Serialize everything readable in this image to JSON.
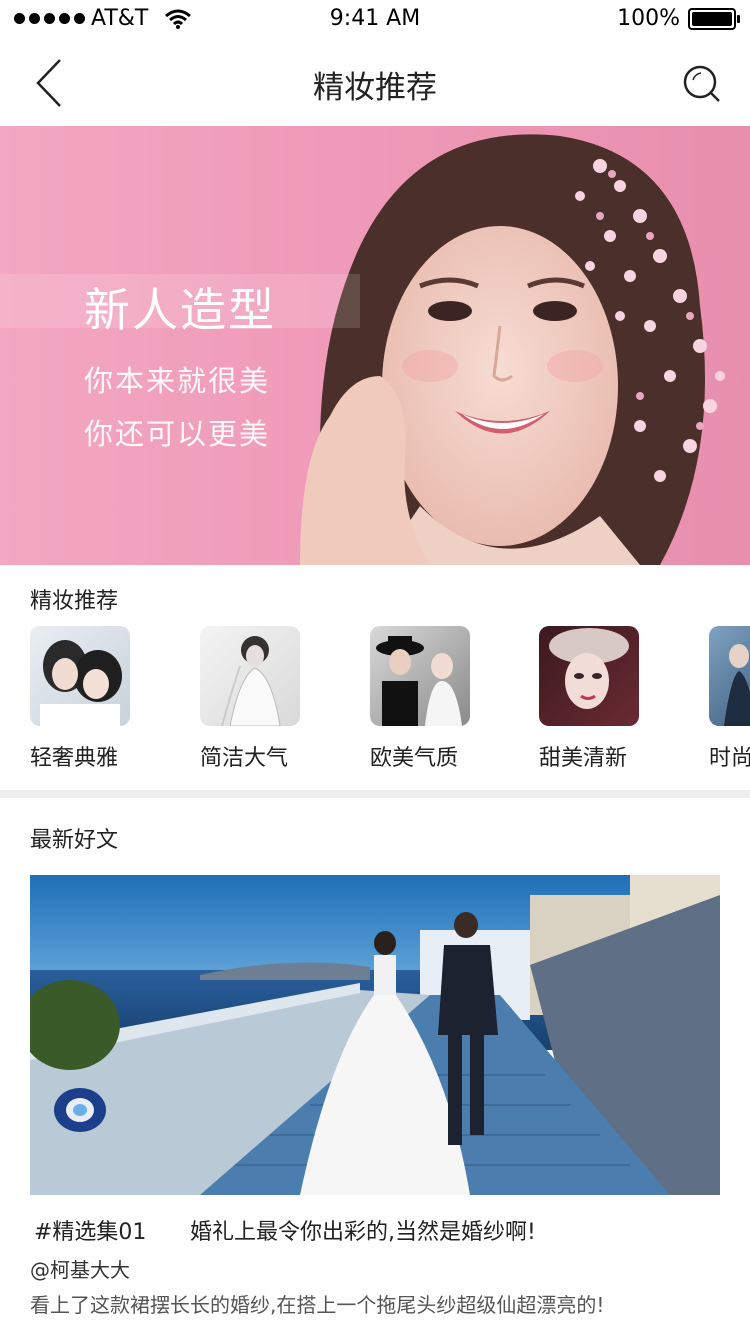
{
  "status_bar": {
    "carrier": "AT&T",
    "time": "9:41 AM",
    "battery": "100%"
  },
  "nav": {
    "title": "精妆推荐"
  },
  "hero": {
    "title": "新人造型",
    "line1": "你本来就很美",
    "line2": "你还可以更美"
  },
  "section_picks": {
    "title": "精妆推荐",
    "items": [
      {
        "label": "轻奢典雅"
      },
      {
        "label": "简洁大气"
      },
      {
        "label": "欧美气质"
      },
      {
        "label": "甜美清新"
      },
      {
        "label": "时尚"
      }
    ]
  },
  "section_articles": {
    "title": "最新好文",
    "article": {
      "tag": "#精选集01",
      "headline": "婚礼上最令你出彩的,当然是婚纱啊!",
      "author": "@柯基大大",
      "description": "看上了这款裙摆长长的婚纱,在搭上一个拖尾头纱超级仙超漂亮的!"
    }
  }
}
